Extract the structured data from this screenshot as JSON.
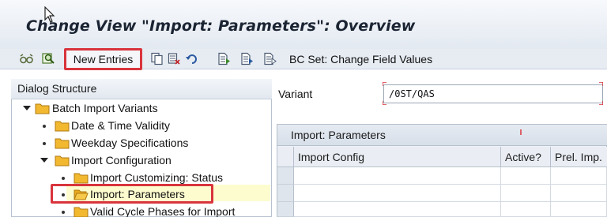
{
  "window": {
    "title": "Change View \"Import: Parameters\": Overview"
  },
  "toolbar": {
    "new_entries_label": "New Entries",
    "bcset_label": "BC Set: Change Field Values",
    "icons": [
      "glasses-icon",
      "find-icon",
      "copy-icon",
      "delete-icon",
      "undo-icon",
      "select-all-icon",
      "select-block-icon",
      "deselect-all-icon"
    ]
  },
  "dialog_structure": {
    "header": "Dialog Structure",
    "items": [
      {
        "label": "Batch Import Variants",
        "level": 0,
        "expanded": true
      },
      {
        "label": "Date & Time Validity",
        "level": 1
      },
      {
        "label": "Weekday Specifications",
        "level": 1
      },
      {
        "label": "Import Configuration",
        "level": 1,
        "expanded": true
      },
      {
        "label": "Import Customizing: Status",
        "level": 2
      },
      {
        "label": "Import: Parameters",
        "level": 2,
        "selected": true
      },
      {
        "label": "Valid Cycle Phases for Import",
        "level": 2
      }
    ]
  },
  "variant": {
    "label": "Variant",
    "value": "/0ST/QAS"
  },
  "table": {
    "title": "Import: Parameters",
    "columns": [
      "Import Config",
      "Active?",
      "Prel. Imp."
    ],
    "rows": [
      [
        "",
        "",
        ""
      ],
      [
        "",
        "",
        ""
      ],
      [
        "",
        "",
        ""
      ]
    ]
  },
  "colors": {
    "highlight_box": "#d9343c",
    "selected_row": "#fdfccf",
    "folder": "#f2b830"
  }
}
